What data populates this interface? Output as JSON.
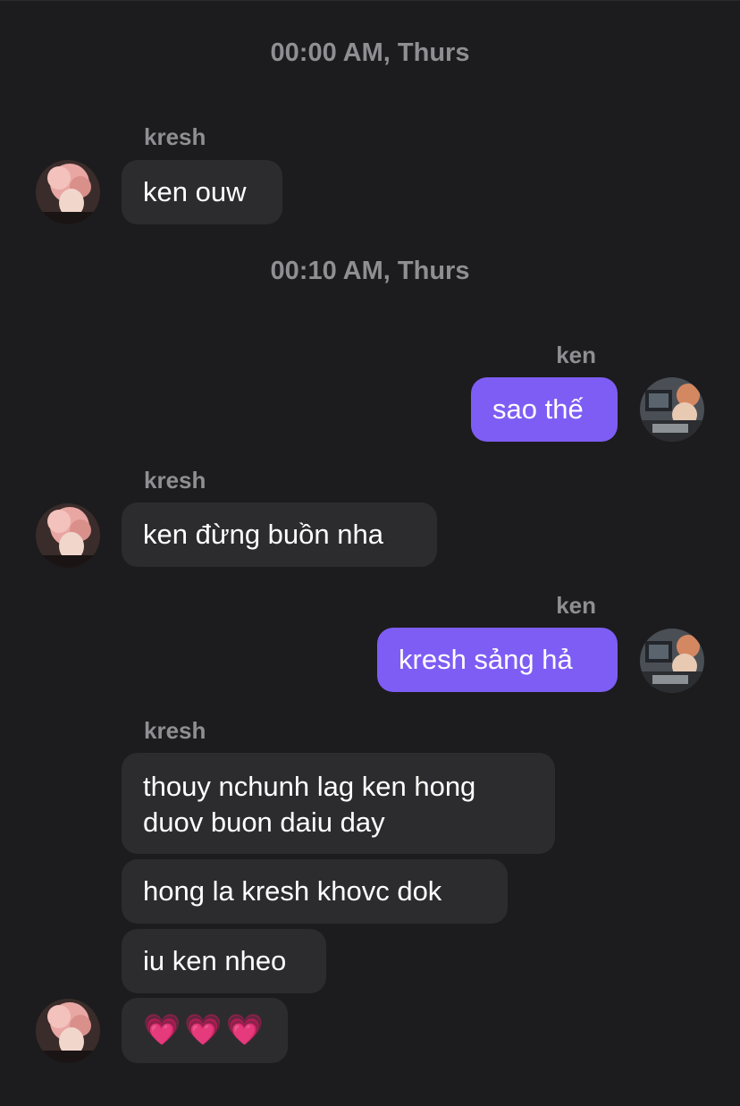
{
  "chat": {
    "timestamps": [
      "00:00 AM, Thurs",
      "00:10 AM, Thurs"
    ],
    "senders": {
      "kresh": "kresh",
      "ken": "ken"
    },
    "messages": [
      {
        "from": "kresh",
        "text": "ken ouw"
      },
      {
        "from": "ken",
        "text": "sao thế"
      },
      {
        "from": "kresh",
        "text": "ken đừng buồn nha"
      },
      {
        "from": "ken",
        "text": "kresh sảng hả"
      },
      {
        "from": "kresh",
        "text": "thouy nchunh lag ken hong duov buon daiu day"
      },
      {
        "from": "kresh",
        "text": "hong la kresh khovc dok"
      },
      {
        "from": "kresh",
        "text": "iu ken nheo"
      },
      {
        "from": "kresh",
        "text": "💗💗💗"
      }
    ]
  },
  "avatars": {
    "kresh": "avatar-pink-hair-photo",
    "ken": "avatar-studio-photo"
  },
  "colors": {
    "background": "#1c1c1e",
    "incoming_bubble": "#2c2c2e",
    "outgoing_bubble": "#7e5df5",
    "meta_text": "#8e8e93",
    "message_text": "#ffffff"
  }
}
